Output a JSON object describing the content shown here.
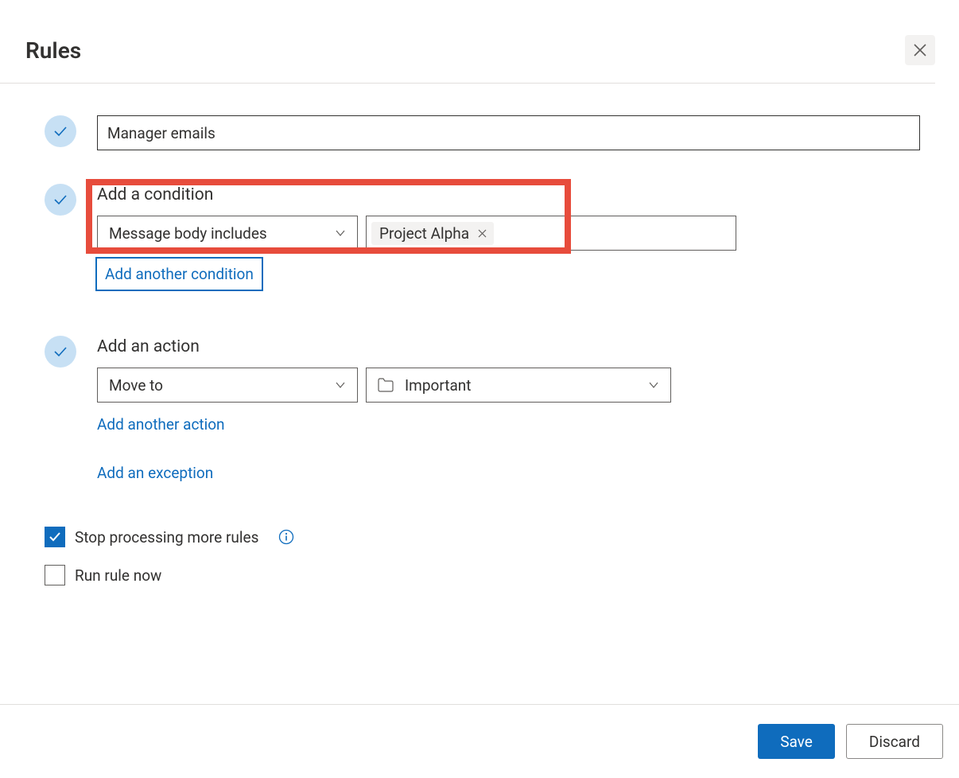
{
  "header": {
    "title": "Rules"
  },
  "rule_name": {
    "value": "Manager emails"
  },
  "condition": {
    "section_label": "Add a condition",
    "type_label": "Message body includes",
    "tag_value": "Project Alpha",
    "add_another": "Add another condition"
  },
  "action": {
    "section_label": "Add an action",
    "type_label": "Move to",
    "folder_label": "Important",
    "add_another": "Add another action",
    "add_exception": "Add an exception"
  },
  "options": {
    "stop_processing": {
      "label": "Stop processing more rules",
      "checked": true
    },
    "run_now": {
      "label": "Run rule now",
      "checked": false
    }
  },
  "footer": {
    "save": "Save",
    "discard": "Discard"
  }
}
